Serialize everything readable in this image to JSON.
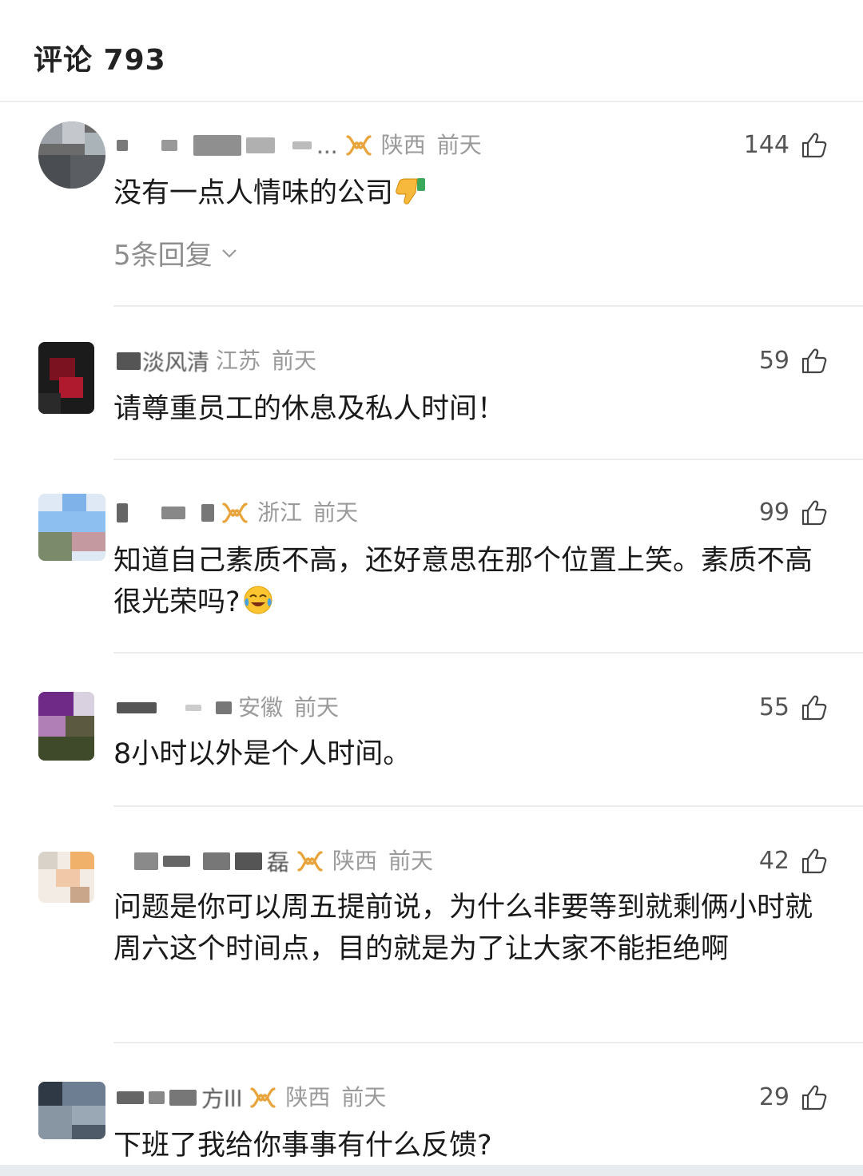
{
  "header": {
    "title": "评论 793"
  },
  "comments": [
    {
      "name_tail": "...",
      "vip": true,
      "location": "陕西",
      "time": "前天",
      "likes": "144",
      "text": "没有一点人情味的公司",
      "emoji": "thumbs-down-emoji",
      "replies": "5条回复"
    },
    {
      "name_tail": "淡风清",
      "vip": false,
      "location": "江苏",
      "time": "前天",
      "likes": "59",
      "text": "请尊重员工的休息及私人时间！"
    },
    {
      "name_tail": "",
      "vip": true,
      "location": "浙江",
      "time": "前天",
      "likes": "99",
      "text": "知道自己素质不高，还好意思在那个位置上笑。素质不高很光荣吗?",
      "emoji": "laughing-crying-emoji"
    },
    {
      "name_tail": "",
      "vip": false,
      "location": "安徽",
      "time": "前天",
      "likes": "55",
      "text": "8小时以外是个人时间。"
    },
    {
      "name_tail": "磊",
      "vip": true,
      "location": "陕西",
      "time": "前天",
      "likes": "42",
      "text": "问题是你可以周五提前说，为什么非要等到就剩俩小时就周六这个时间点，目的就是为了让大家不能拒绝啊"
    },
    {
      "name_tail": "方lll",
      "vip": true,
      "location": "陕西",
      "time": "前天",
      "likes": "29",
      "text": "下班了我给你事事有什么反馈?"
    }
  ],
  "colors": {
    "vip_gold": "#e8a33a",
    "meta_gray": "#9a9a9a",
    "divider": "#ececec"
  }
}
